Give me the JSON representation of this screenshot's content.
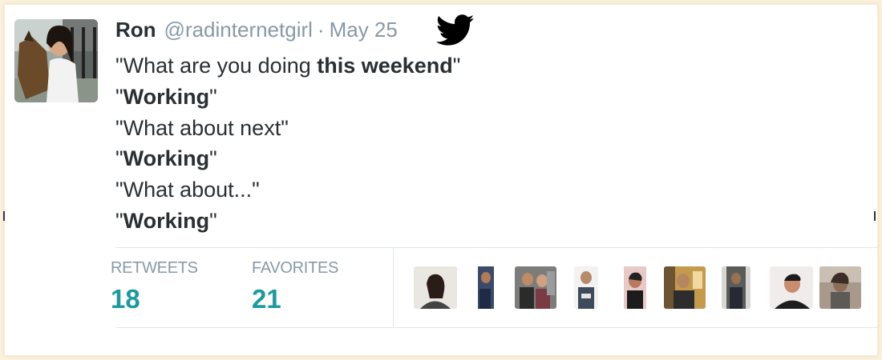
{
  "tweet": {
    "display_name": "Ron",
    "handle": "@radinternetgirl",
    "separator": "·",
    "date": "May 25",
    "lines": [
      {
        "pre": "\"What are you doing ",
        "bold": "this weekend",
        "post": "\""
      },
      {
        "pre": "\"",
        "bold": "Working",
        "post": "\""
      },
      {
        "pre": "\"What about next\"",
        "bold": "",
        "post": ""
      },
      {
        "pre": "\"",
        "bold": "Working",
        "post": "\""
      },
      {
        "pre": "\"What about...\"",
        "bold": "",
        "post": ""
      },
      {
        "pre": "\"",
        "bold": "Working",
        "post": "\""
      }
    ]
  },
  "stats": {
    "retweets_label": "RETWEETS",
    "retweets_value": "18",
    "favorites_label": "FAVORITES",
    "favorites_value": "21"
  },
  "colors": {
    "accent": "#1b9aa1",
    "twitter_blue": "#000000",
    "muted": "#8899a6",
    "text": "#292f33"
  },
  "icons": {
    "brand": "twitter-bird-icon"
  }
}
